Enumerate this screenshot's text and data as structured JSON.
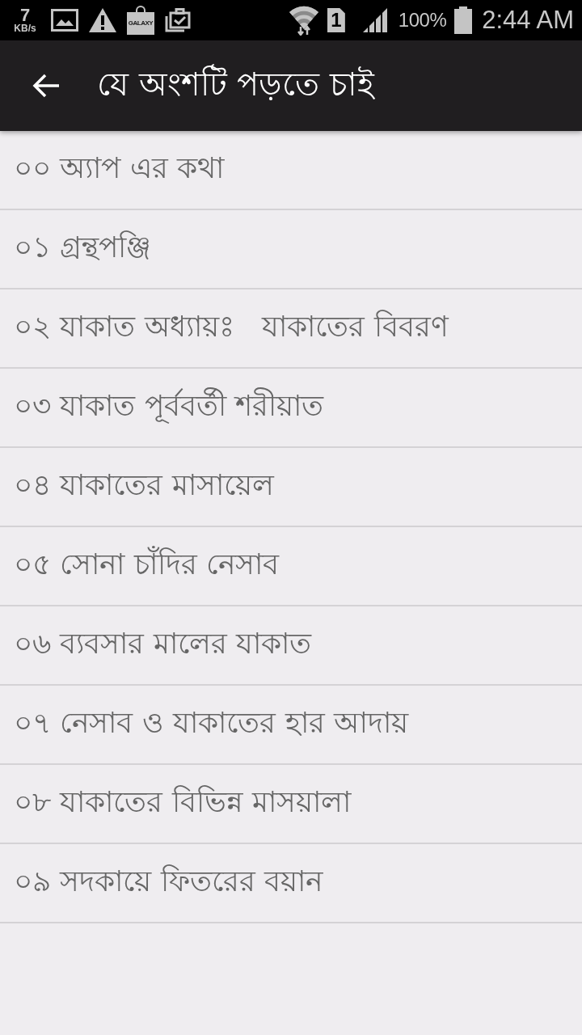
{
  "status_bar": {
    "speed_value": "7",
    "speed_unit": "KB/s",
    "bag_label": "GALAXY",
    "sim_number": "1",
    "battery": "100%",
    "time": "2:44 AM"
  },
  "app_bar": {
    "title": "যে অংশটি পড়তে চাই"
  },
  "list": {
    "items": [
      {
        "label": "০০ অ্যাপ এর কথা"
      },
      {
        "label": "০১ গ্রন্থপঞ্জি"
      },
      {
        "label": "০২ যাকাত অধ্যায়ঃ   যাকাতের বিবরণ"
      },
      {
        "label": "০৩ যাকাত পূর্ববর্তী শরীয়াত"
      },
      {
        "label": "০৪ যাকাতের মাসায়েল"
      },
      {
        "label": "০৫ সোনা চাঁদির নেসাব"
      },
      {
        "label": "০৬ ব্যবসার মালের যাকাত"
      },
      {
        "label": "০৭ নেসাব ও যাকাতের হার আদায়"
      },
      {
        "label": "০৮ যাকাতের বিভিন্ন মাসয়ালা"
      },
      {
        "label": "০৯ সদকায়ে ফিতরের বয়ান"
      }
    ]
  }
}
